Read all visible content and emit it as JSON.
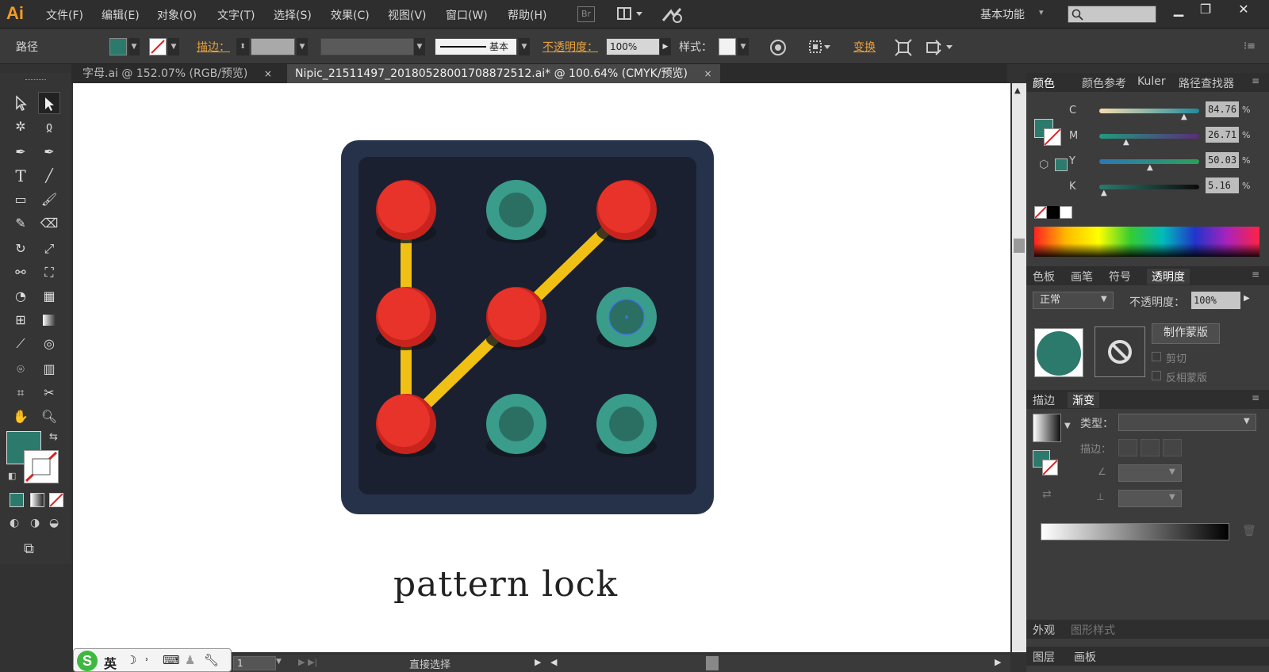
{
  "app": {
    "logo": "Ai"
  },
  "menus": [
    "文件(F)",
    "编辑(E)",
    "对象(O)",
    "文字(T)",
    "选择(S)",
    "效果(C)",
    "视图(V)",
    "窗口(W)",
    "帮助(H)"
  ],
  "menubar_icons": {
    "bridge": "Br",
    "arrange": "arrange-documents-icon",
    "gpu": "gpu-performance-icon"
  },
  "workspace": "基本功能",
  "search": {
    "placeholder": ""
  },
  "control": {
    "selection_type": "路径",
    "stroke_label": "描边：",
    "stroke_style": "基本",
    "opacity_label": "不透明度：",
    "opacity_value": "100%",
    "style_label": "样式：",
    "transform_label": "变换",
    "fill_color": "#2c7a6c"
  },
  "tabs": [
    {
      "label": "字母.ai @ 152.07% (RGB/预览)",
      "close": "×",
      "active": false
    },
    {
      "label": "Nipic_21511497_20180528001708872512.ai* @ 100.64% (CMYK/预览)",
      "close": "×",
      "active": true
    }
  ],
  "artwork": {
    "caption": "pattern lock",
    "box_color": "#25324a",
    "inner_color": "#1b2030",
    "line_color": "#f0c014",
    "active_dot_color": "#e8332a",
    "inactive_dot_color": "#3a9c8a",
    "inactive_dot_core": "#2b6f63",
    "grid": [
      [
        "active",
        "inactive",
        "active"
      ],
      [
        "active",
        "active",
        "selected"
      ],
      [
        "active",
        "inactive",
        "inactive"
      ]
    ],
    "path": [
      [
        2,
        0
      ],
      [
        1,
        0
      ],
      [
        0,
        0
      ]
    ],
    "path2": [
      [
        2,
        0
      ],
      [
        1,
        1
      ],
      [
        0,
        2
      ]
    ]
  },
  "color_panel": {
    "tabs": [
      "颜色",
      "颜色参考",
      "Kuler",
      "路径查找器"
    ],
    "channels": [
      {
        "name": "C",
        "value": "84.76",
        "unit": "%",
        "level": 0.8476
      },
      {
        "name": "M",
        "value": "26.71",
        "unit": "%",
        "level": 0.2671
      },
      {
        "name": "Y",
        "value": "50.03",
        "unit": "%",
        "level": 0.5003
      },
      {
        "name": "K",
        "value": "5.16",
        "unit": "%",
        "level": 0.0516
      }
    ]
  },
  "transparency_panel": {
    "tabs": [
      "色板",
      "画笔",
      "符号",
      "透明度"
    ],
    "blend_mode": "正常",
    "opacity_label": "不透明度：",
    "opacity_value": "100%",
    "make_mask": "制作蒙版",
    "clip": "剪切",
    "invert_mask": "反相蒙版"
  },
  "gradient_panel": {
    "tabs": [
      "描边",
      "渐变"
    ],
    "type_label": "类型：",
    "stroke_label": "描边："
  },
  "appearance_panel": {
    "tabs": [
      "外观",
      "图形样式"
    ]
  },
  "layers_panel": {
    "tabs": [
      "图层",
      "画板"
    ]
  },
  "status": {
    "zoom_page": "1",
    "tool": "直接选择"
  },
  "ime": {
    "lang": "英"
  }
}
